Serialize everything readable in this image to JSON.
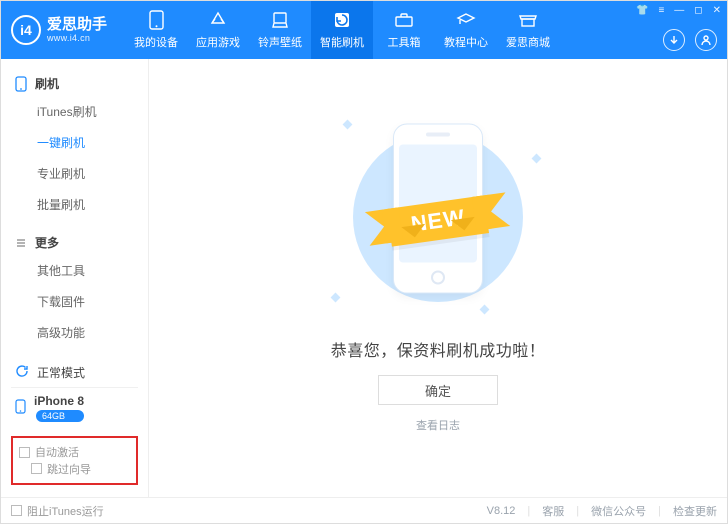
{
  "app": {
    "title": "爱思助手",
    "url": "www.i4.cn",
    "logo_letters": "i4"
  },
  "nav": {
    "items": [
      {
        "label": "我的设备",
        "icon": "device"
      },
      {
        "label": "应用游戏",
        "icon": "apps"
      },
      {
        "label": "铃声壁纸",
        "icon": "ringtone"
      },
      {
        "label": "智能刷机",
        "icon": "flash",
        "active": true
      },
      {
        "label": "工具箱",
        "icon": "toolbox"
      },
      {
        "label": "教程中心",
        "icon": "tutorial"
      },
      {
        "label": "爱思商城",
        "icon": "store"
      }
    ]
  },
  "sidebar": {
    "sections": [
      {
        "title": "刷机",
        "items": [
          {
            "label": "iTunes刷机"
          },
          {
            "label": "一键刷机",
            "active": true
          },
          {
            "label": "专业刷机"
          },
          {
            "label": "批量刷机"
          }
        ]
      },
      {
        "title": "更多",
        "items": [
          {
            "label": "其他工具"
          },
          {
            "label": "下载固件"
          },
          {
            "label": "高级功能"
          }
        ]
      }
    ],
    "mode": {
      "normal": "正常模式",
      "device": "iPhone 8",
      "storage": "64GB"
    },
    "redbox": {
      "auto_activate": "自动激活",
      "skip_wizard": "跳过向导"
    }
  },
  "main": {
    "ribbon": "NEW",
    "success": "恭喜您，保资料刷机成功啦！",
    "ok": "确定",
    "log": "查看日志"
  },
  "footer": {
    "block_itunes": "阻止iTunes运行",
    "version": "V8.12",
    "support": "客服",
    "wechat": "微信公众号",
    "update": "检查更新"
  }
}
